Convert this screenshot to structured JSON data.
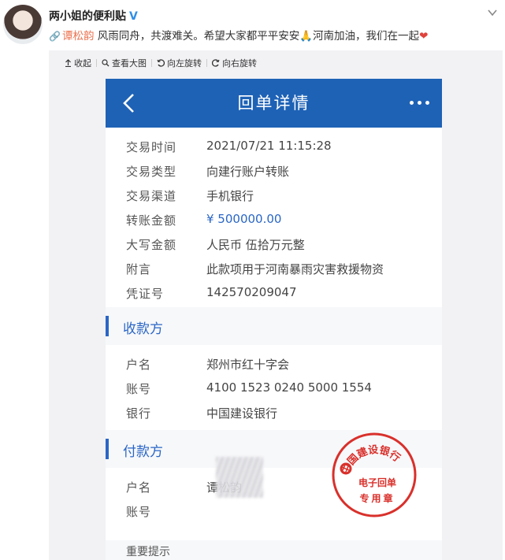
{
  "post": {
    "author": "两小姐的便利贴",
    "verified_icon": "verified-v-icon",
    "mention": "谭松韵",
    "text": " 风雨同舟，共渡难关。希望大家都平平安安🙏河南加油，我们在一起",
    "heart": "❤"
  },
  "toolbar": {
    "collect": "收起",
    "view_large": "查看大图",
    "rotate_left": "向左旋转",
    "rotate_right": "向右旋转"
  },
  "receipt": {
    "title": "回单详情",
    "fields": [
      {
        "label": "交易时间",
        "value": "2021/07/21 11:15:28"
      },
      {
        "label": "交易类型",
        "value": "向建行账户转账"
      },
      {
        "label": "交易渠道",
        "value": "手机银行"
      },
      {
        "label": "转账金额",
        "value": "¥ 500000.00"
      },
      {
        "label": "大写金额",
        "value": "人民币 伍拾万元整"
      },
      {
        "label": "附言",
        "value": "此款项用于河南暴雨灾害救援物资"
      },
      {
        "label": "凭证号",
        "value": "142570209047"
      }
    ],
    "payee": {
      "section_title": "收款方",
      "fields": [
        {
          "label": "户名",
          "value": "郑州市红十字会"
        },
        {
          "label": "账号",
          "value": "4100 1523 0240 5000 1554"
        },
        {
          "label": "银行",
          "value": "中国建设银行"
        }
      ]
    },
    "payer": {
      "section_title": "付款方",
      "fields": [
        {
          "label": "户名",
          "value": "谭松韵"
        },
        {
          "label": "账号",
          "value": ""
        }
      ]
    },
    "stamp": {
      "ring_text": "中国建设银行",
      "line1": "电子回单",
      "line2": "专用章"
    },
    "footer_hint": "重要提示"
  },
  "colors": {
    "header_blue": "#1e62b6",
    "accent_blue": "#2a66c6",
    "stamp_red": "#d9302b",
    "mention_orange": "#eb7350"
  }
}
